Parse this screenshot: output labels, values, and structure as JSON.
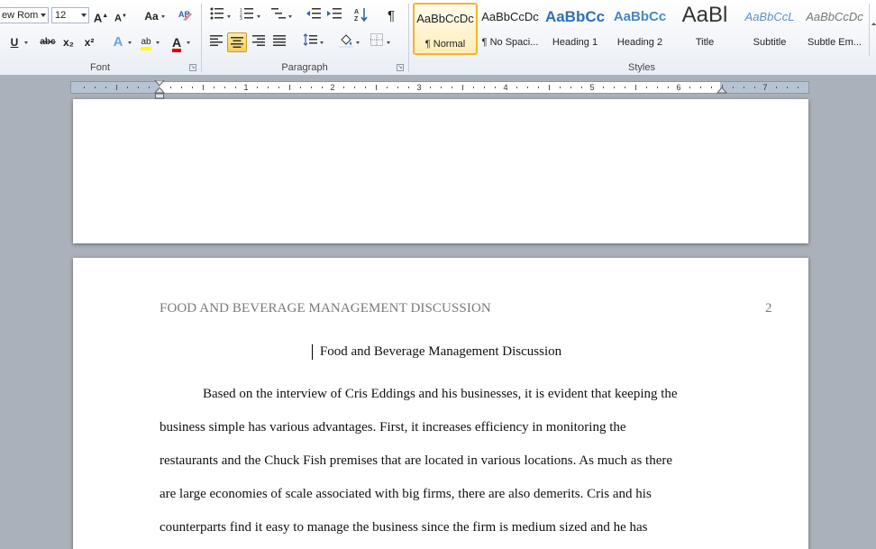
{
  "font": {
    "name": "ew Rom",
    "size": "12",
    "group_label": "Font",
    "grow": "A",
    "shrink": "A",
    "case": "Aa",
    "bold_u": "U",
    "strike": "abc",
    "sub": "x₂",
    "sup": "x²",
    "effects": "A",
    "highlight": "ab",
    "color": "A"
  },
  "paragraph": {
    "group_label": "Paragraph",
    "show_marks": "¶"
  },
  "styles": {
    "group_label": "Styles",
    "items": [
      {
        "sample": "AaBbCcDc",
        "name": "¶ Normal"
      },
      {
        "sample": "AaBbCcDc",
        "name": "¶ No Spaci..."
      },
      {
        "sample": "AaBbCc",
        "name": "Heading 1"
      },
      {
        "sample": "AaBbCc",
        "name": "Heading 2"
      },
      {
        "sample": "AaBl",
        "name": "Title"
      },
      {
        "sample": "AaBbCcL",
        "name": "Subtitle"
      },
      {
        "sample": "AaBbCcDc",
        "name": "Subtle Em..."
      }
    ]
  },
  "ruler": {
    "numbers": [
      "1",
      "2",
      "3",
      "4",
      "5",
      "6",
      "7"
    ]
  },
  "document": {
    "header_title": "FOOD AND BEVERAGE MANAGEMENT DISCUSSION",
    "page_number": "2",
    "title": "Food and Beverage Management Discussion",
    "lines": [
      "Based on the interview of Cris Eddings and his businesses, it is evident that keeping the",
      "business simple has various advantages. First, it increases efficiency in monitoring the",
      "restaurants and the Chuck Fish premises that are located in various locations. As much as there",
      "are large economies of scale associated with big firms, there are also demerits. Cris and his",
      "counterparts find it easy to manage the business since the firm is medium sized and he has"
    ]
  },
  "colors": {
    "accent_selected": "#f3b52e",
    "heading": "#2e6fb8",
    "highlight": "#ffff00",
    "font_color": "#e00000"
  }
}
